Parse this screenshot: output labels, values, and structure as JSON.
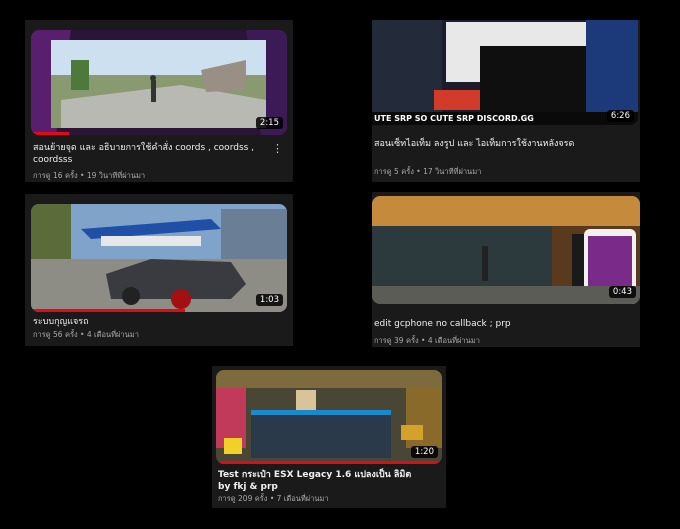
{
  "videos": [
    {
      "title": "สอนย้ายจุด และ อธิบายการใช้คำสั่ง coords , coordss , coordsss",
      "meta": "การดู 16 ครั้ง • 19 วินาทีที่ผ่านมา",
      "duration": "2:15",
      "progress": 0.15,
      "more_icon": "vertical-dots-icon"
    },
    {
      "title": "สอนเซ็ทไอเท็ม ลงรูป และ ไอเท็มการใช้งานหลังจรด",
      "meta": "การดู 5 ครั้ง • 17 วินาทีที่ผ่านมา",
      "duration": "6:26",
      "overlay_text": "UTE SRP   SO CUTE SRP   DISCORD.GG",
      "progress": 0.0
    },
    {
      "title": "ระบบกุญแจรถ",
      "meta": "การดู 56 ครั้ง • 4 เดือนที่ผ่านมา",
      "duration": "1:03",
      "progress": 0.6
    },
    {
      "title": "edit gcphone no callback ; prp",
      "meta": "การดู 39 ครั้ง • 4 เดือนที่ผ่านมา",
      "duration": "0:43",
      "progress": 0.0
    },
    {
      "title": "Test กระเป๋า ESX Legacy 1.6 แปลงเป็น ลิมิต by fkj & prp",
      "meta": "การดู 209 ครั้ง • 7 เดือนที่ผ่านมา",
      "duration": "1:20",
      "progress": 1.0
    }
  ],
  "colors": {
    "progress": "#e50914",
    "card_bg": "#1a1a1a"
  }
}
